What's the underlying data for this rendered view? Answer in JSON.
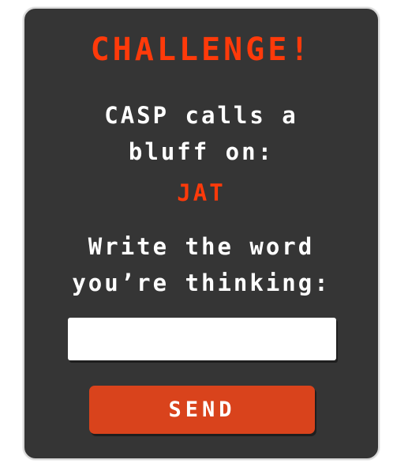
{
  "dialog": {
    "title": "CHALLENGE!",
    "call_line_1": "CASP calls a",
    "call_line_2": "bluff on:",
    "target_player": "JAT",
    "prompt_line_1": "Write the word",
    "prompt_line_2": "you’re thinking:",
    "input_value": "",
    "input_placeholder": "",
    "send_label": "SEND"
  },
  "colors": {
    "panel_background": "#353535",
    "accent_red": "#ff3a0a",
    "button_background": "#d9431c",
    "text": "#ffffff"
  }
}
